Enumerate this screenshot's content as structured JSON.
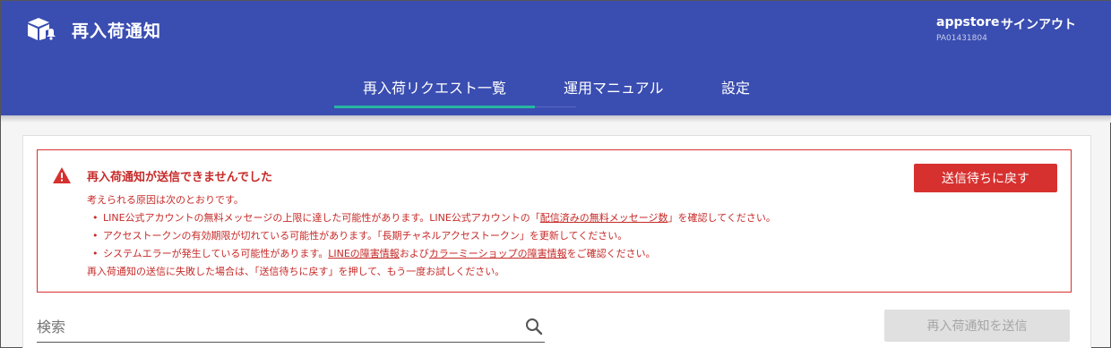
{
  "header": {
    "app_title": "再入荷通知",
    "logo_icon": "package-bell-icon",
    "account_name": "appstore",
    "account_id": "PA01431804",
    "signout_label": "サインアウト"
  },
  "nav": {
    "tabs": [
      {
        "label": "再入荷リクエスト一覧",
        "active": true
      },
      {
        "label": "運用マニュアル",
        "active": false
      },
      {
        "label": "設定",
        "active": false
      }
    ]
  },
  "alert": {
    "icon": "warning-icon",
    "title": "再入荷通知が送信できませんでした",
    "intro": "考えられる原因は次のとおりです。",
    "reasons": [
      {
        "pre": "LINE公式アカウントの無料メッセージの上限に達した可能性があります。LINE公式アカウントの「",
        "link": "配信済みの無料メッセージ数",
        "post": "」を確認してください。"
      },
      {
        "pre": "アクセストークンの有効期限が切れている可能性があります。「長期チャネルアクセストークン」を更新してください。"
      },
      {
        "pre": "システムエラーが発生している可能性があります。",
        "link": "LINEの障害情報",
        "mid": "および",
        "link2": "カラーミーショップの障害情報",
        "post": "をご確認ください。"
      }
    ],
    "footer": "再入荷通知の送信に失敗した場合は、「送信待ちに戻す」を押して、もう一度お試しください。",
    "button_label": "送信待ちに戻す"
  },
  "search": {
    "placeholder": "検索",
    "value": ""
  },
  "send_button_label": "再入荷通知を送信",
  "colors": {
    "header_bg": "#3a4db1",
    "tab_indicator": "#26b8a0",
    "error": "#d6312f"
  }
}
